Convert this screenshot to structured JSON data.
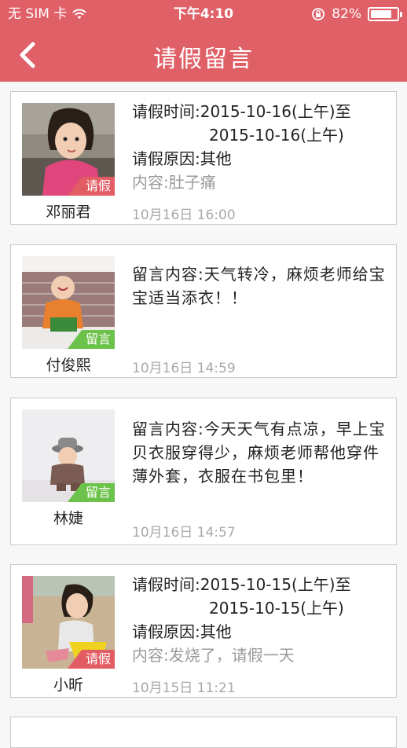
{
  "status_bar": {
    "carrier": "无 SIM 卡",
    "time": "下午4:10",
    "battery_percent": "82%",
    "battery_level": 0.82
  },
  "nav": {
    "title": "请假留言"
  },
  "cards": [
    {
      "type": "leave",
      "tag": "请假",
      "name": "邓丽君",
      "time_line1": "请假时间:2015-10-16(上午)至",
      "time_line2": "2015-10-16(上午)",
      "reason": "请假原因:其他",
      "content": "内容:肚子痛",
      "timestamp": "10月16日 16:00"
    },
    {
      "type": "message",
      "tag": "留言",
      "name": "付俊熙",
      "message": "留言内容:天气转冷，麻烦老师给宝宝适当添衣！！",
      "timestamp": "10月16日 14:59"
    },
    {
      "type": "message",
      "tag": "留言",
      "name": "林婕",
      "message": "留言内容:今天天气有点凉，早上宝贝衣服穿得少，麻烦老师帮他穿件薄外套，衣服在书包里！",
      "timestamp": "10月16日 14:57"
    },
    {
      "type": "leave",
      "tag": "请假",
      "name": "小昕",
      "time_line1": "请假时间:2015-10-15(上午)至",
      "time_line2": "2015-10-15(上午)",
      "reason": "请假原因:其他",
      "content": "内容:发烧了，请假一天",
      "timestamp": "10月15日 11:21"
    }
  ],
  "colors": {
    "header": "#e06068",
    "leave_tag": "#e25c64",
    "message_tag": "#6cc24a"
  },
  "icons": [
    "wifi-icon",
    "lock-rotation-icon",
    "battery-icon",
    "back-arrow-icon"
  ]
}
